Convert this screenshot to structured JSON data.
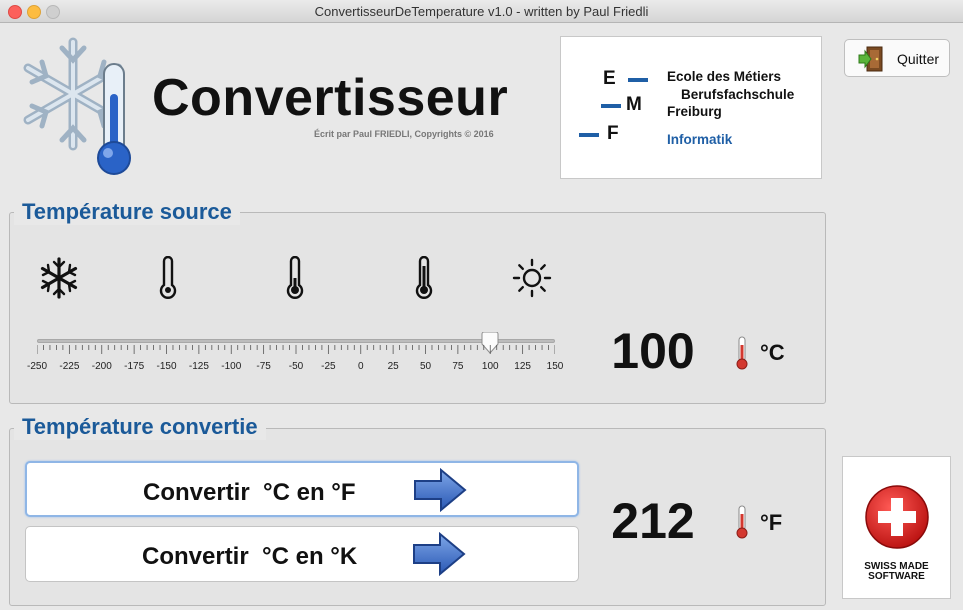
{
  "window": {
    "title": "ConvertisseurDeTemperature v1.0 - written by Paul Friedli"
  },
  "header": {
    "app_title": "Convertisseur",
    "copyright": "Écrit par Paul FRIEDLI, Copyrights © 2016",
    "app_icon": "snowflake-thermometer-icon"
  },
  "school_logo": {
    "letters": [
      "E",
      "M",
      "F"
    ],
    "line1": "Ecole des Métiers",
    "line2": "Berufsfachschule",
    "line3": "Freiburg",
    "line4": "Informatik",
    "accent_color": "#1f5fa6"
  },
  "quit_button": {
    "label": "Quitter",
    "icon": "exit-door-icon"
  },
  "source_group": {
    "title": "Température source",
    "scale_icons": [
      "snowflake-icon",
      "thermometer-empty-icon",
      "thermometer-low-icon",
      "thermometer-high-icon",
      "sun-icon"
    ],
    "slider": {
      "min": -250,
      "max": 150,
      "value": 100,
      "tick_labels": [
        "-250",
        "-225",
        "-200",
        "-175",
        "-150",
        "-125",
        "-100",
        "-75",
        "-50",
        "-25",
        "0",
        "25",
        "50",
        "75",
        "100",
        "125",
        "150"
      ]
    },
    "value": "100",
    "unit": "°C"
  },
  "converted_group": {
    "title": "Température convertie",
    "buttons": [
      {
        "label": "Convertir  °C en °F",
        "selected": true
      },
      {
        "label": "Convertir  °C en °K",
        "selected": false
      }
    ],
    "value": "212",
    "unit": "°F"
  },
  "swiss_badge": {
    "line1": "SWISS MADE",
    "line2": "SOFTWARE",
    "color": "#e21d24"
  },
  "colors": {
    "title_blue": "#1b5a99",
    "arrow_blue": "#3a6fc4",
    "thermo_red": "#d3382f"
  }
}
